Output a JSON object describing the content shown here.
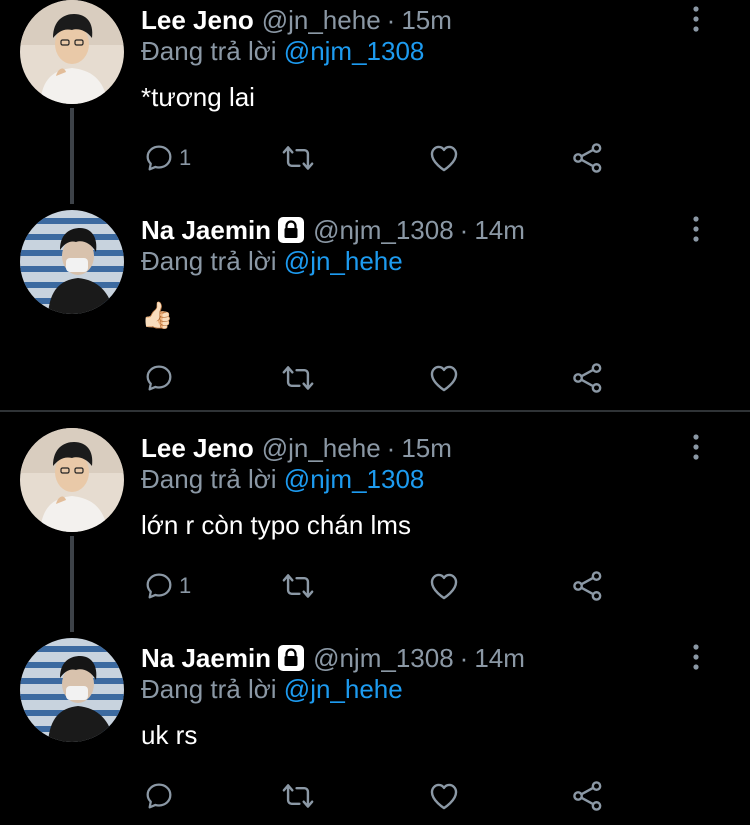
{
  "colors": {
    "background": "#000000",
    "name": "#ffffff",
    "muted": "#8b98a5",
    "mention": "#1d9bf0",
    "divider": "#2f3336",
    "thread_line": "#3d4248"
  },
  "tweets": [
    {
      "name": "Lee Jeno",
      "handle": "@jn_hehe",
      "separator": "·",
      "time": "15m",
      "locked": false,
      "reply_prefix": "Đang trả lời",
      "reply_mention": "@njm_1308",
      "text": "*tương lai",
      "reply_count": "1",
      "icons": [
        "reply-icon",
        "retweet-icon",
        "like-icon",
        "share-icon",
        "more-icon"
      ]
    },
    {
      "name": "Na Jaemin",
      "handle": "@njm_1308",
      "separator": "·",
      "time": "14m",
      "locked": true,
      "reply_prefix": "Đang trả lời",
      "reply_mention": "@jn_hehe",
      "text": "👍🏻",
      "reply_count": "",
      "icons": [
        "reply-icon",
        "retweet-icon",
        "like-icon",
        "share-icon",
        "more-icon"
      ]
    },
    {
      "name": "Lee Jeno",
      "handle": "@jn_hehe",
      "separator": "·",
      "time": "15m",
      "locked": false,
      "reply_prefix": "Đang trả lời",
      "reply_mention": "@njm_1308",
      "text": "lớn r còn typo chán lms",
      "reply_count": "1",
      "icons": [
        "reply-icon",
        "retweet-icon",
        "like-icon",
        "share-icon",
        "more-icon"
      ]
    },
    {
      "name": "Na Jaemin",
      "handle": "@njm_1308",
      "separator": "·",
      "time": "14m",
      "locked": true,
      "reply_prefix": "Đang trả lời",
      "reply_mention": "@jn_hehe",
      "text": "uk rs",
      "reply_count": "",
      "icons": [
        "reply-icon",
        "retweet-icon",
        "like-icon",
        "share-icon",
        "more-icon"
      ]
    }
  ]
}
